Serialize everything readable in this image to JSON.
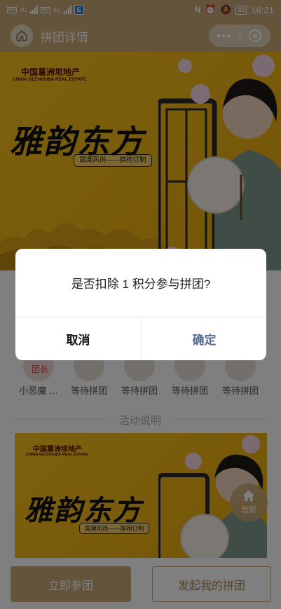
{
  "status_bar": {
    "sim1_tag": "HD",
    "sim1_net": "4G",
    "sim2_tag": "HD",
    "sim2_net": "4G",
    "app_badge": "E",
    "battery": "83",
    "time": "16:21",
    "icons": [
      "nfc-icon",
      "alarm-icon",
      "mute-icon"
    ]
  },
  "nav": {
    "title": "拼团详情",
    "home_icon": "home-icon",
    "more_icon": "more-dots-icon",
    "close_icon": "target-icon"
  },
  "banner": {
    "brand_cn": "中国葛洲坝地产",
    "brand_en": "CHINA GEZHOUBA REAL ESTATE",
    "headline": "雅韵东方",
    "slogan": "国潮风尚——旗袍订制"
  },
  "members": {
    "leader_tag": "团长",
    "leader_name": "小恶魔 …",
    "waiting": [
      "等待拼团",
      "等待拼团",
      "等待拼团",
      "等待拼团"
    ]
  },
  "section": {
    "activity_title": "活动说明"
  },
  "float_home": {
    "label": "首页"
  },
  "bottom": {
    "join_label": "立即参团",
    "start_label": "发起我的拼团"
  },
  "dialog": {
    "message": "是否扣除 1 积分参与拼团?",
    "cancel_label": "取消",
    "confirm_label": "确定"
  },
  "colors": {
    "accent": "#c9a979",
    "banner_yellow": "#f4bd1c",
    "confirm_blue": "#576b95"
  }
}
